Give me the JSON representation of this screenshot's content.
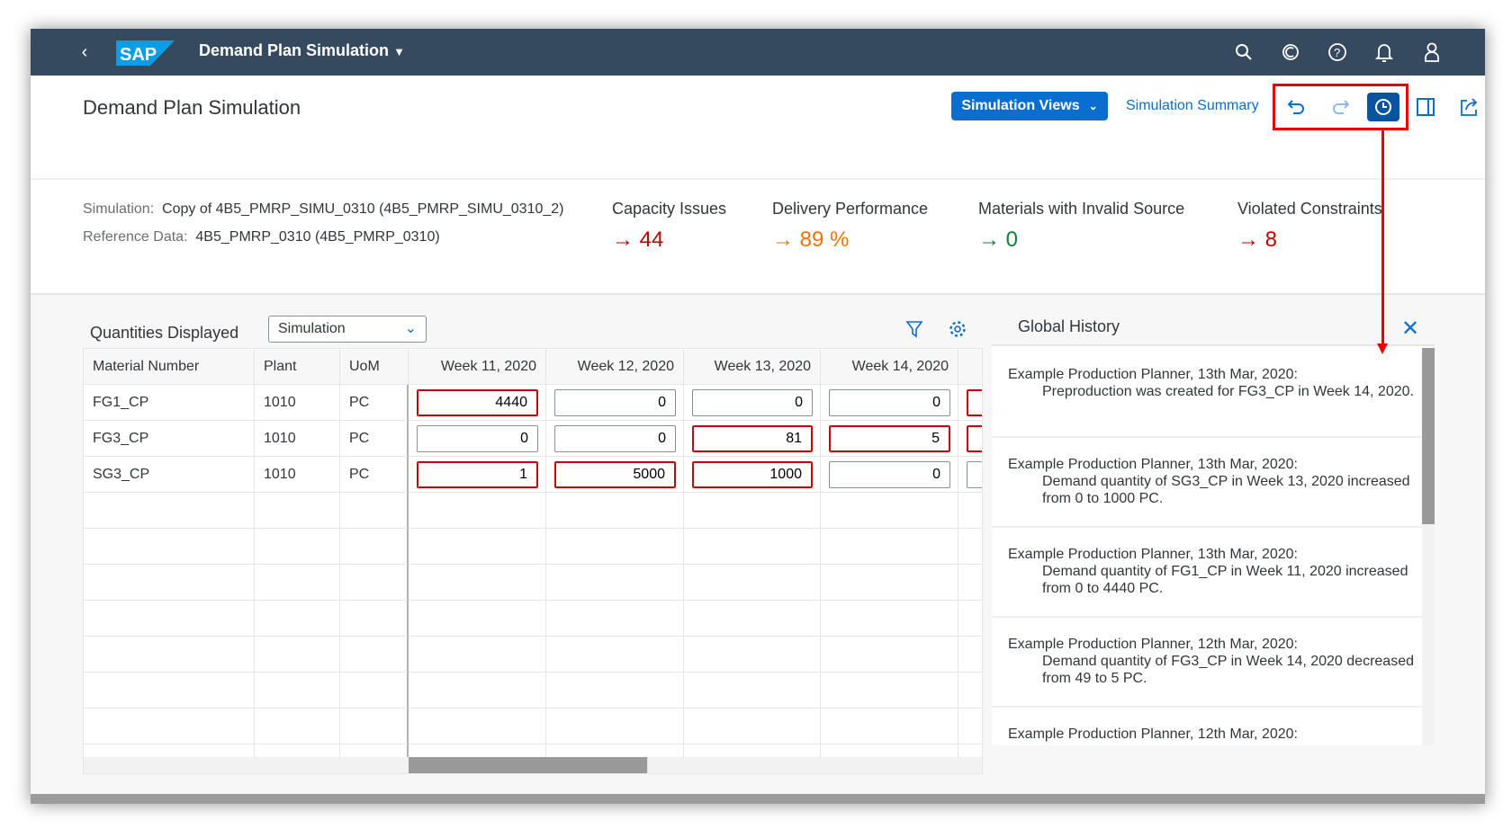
{
  "shell": {
    "title": "Demand Plan Simulation",
    "icons": [
      "search-icon",
      "copilot-icon",
      "help-icon",
      "bell-icon",
      "user-icon"
    ]
  },
  "page": {
    "title": "Demand Plan Simulation",
    "simulation_views": "Simulation Views",
    "simulation_summary": "Simulation Summary"
  },
  "info": {
    "simulation_label": "Simulation:",
    "simulation_value": "Copy of 4B5_PMRP_SIMU_0310 (4B5_PMRP_SIMU_0310_2)",
    "reference_label": "Reference Data:",
    "reference_value": "4B5_PMRP_0310 (4B5_PMRP_0310)"
  },
  "kpis": [
    {
      "label": "Capacity Issues",
      "value": "44",
      "color": "#bb0000"
    },
    {
      "label": "Delivery Performance",
      "value": "89 %",
      "color": "#e9730c"
    },
    {
      "label": "Materials with Invalid Source",
      "value": "0",
      "color": "#107e3e"
    },
    {
      "label": "Violated Constraints",
      "value": "8",
      "color": "#bb0000"
    }
  ],
  "toolbar": {
    "quantities_label": "Quantities Displayed",
    "quantities_value": "Simulation"
  },
  "table": {
    "columns": [
      "Material Number",
      "Plant",
      "UoM",
      "Week 11, 2020",
      "Week 12, 2020",
      "Week 13, 2020",
      "Week 14, 2020"
    ],
    "rows": [
      {
        "material": "FG1_CP",
        "plant": "1010",
        "uom": "PC",
        "values": [
          "4440",
          "0",
          "0",
          "0"
        ],
        "changed": [
          true,
          false,
          false,
          false,
          true
        ]
      },
      {
        "material": "FG3_CP",
        "plant": "1010",
        "uom": "PC",
        "values": [
          "0",
          "0",
          "81",
          "5"
        ],
        "changed": [
          false,
          false,
          true,
          true,
          true
        ]
      },
      {
        "material": "SG3_CP",
        "plant": "1010",
        "uom": "PC",
        "values": [
          "1",
          "5000",
          "1000",
          "0"
        ],
        "changed": [
          true,
          true,
          true,
          false,
          false
        ]
      }
    ]
  },
  "history": {
    "title": "Global History",
    "items": [
      {
        "header": "Example Production Planner, 13th Mar, 2020:",
        "detail": "Preproduction was created for FG3_CP in Week 14, 2020."
      },
      {
        "header": "Example Production Planner, 13th Mar, 2020:",
        "detail": "Demand quantity of SG3_CP in Week 13, 2020 increased from 0 to 1000 PC."
      },
      {
        "header": "Example Production Planner, 13th Mar, 2020:",
        "detail": "Demand quantity of FG1_CP in Week 11, 2020 increased from 0 to 4440 PC."
      },
      {
        "header": "Example Production Planner, 12th Mar, 2020:",
        "detail": "Demand quantity of FG3_CP in Week 14, 2020 decreased from 49 to 5 PC."
      },
      {
        "header": "Example Production Planner, 12th Mar, 2020:",
        "detail": ""
      }
    ]
  },
  "annotation_color": "#ee0000"
}
